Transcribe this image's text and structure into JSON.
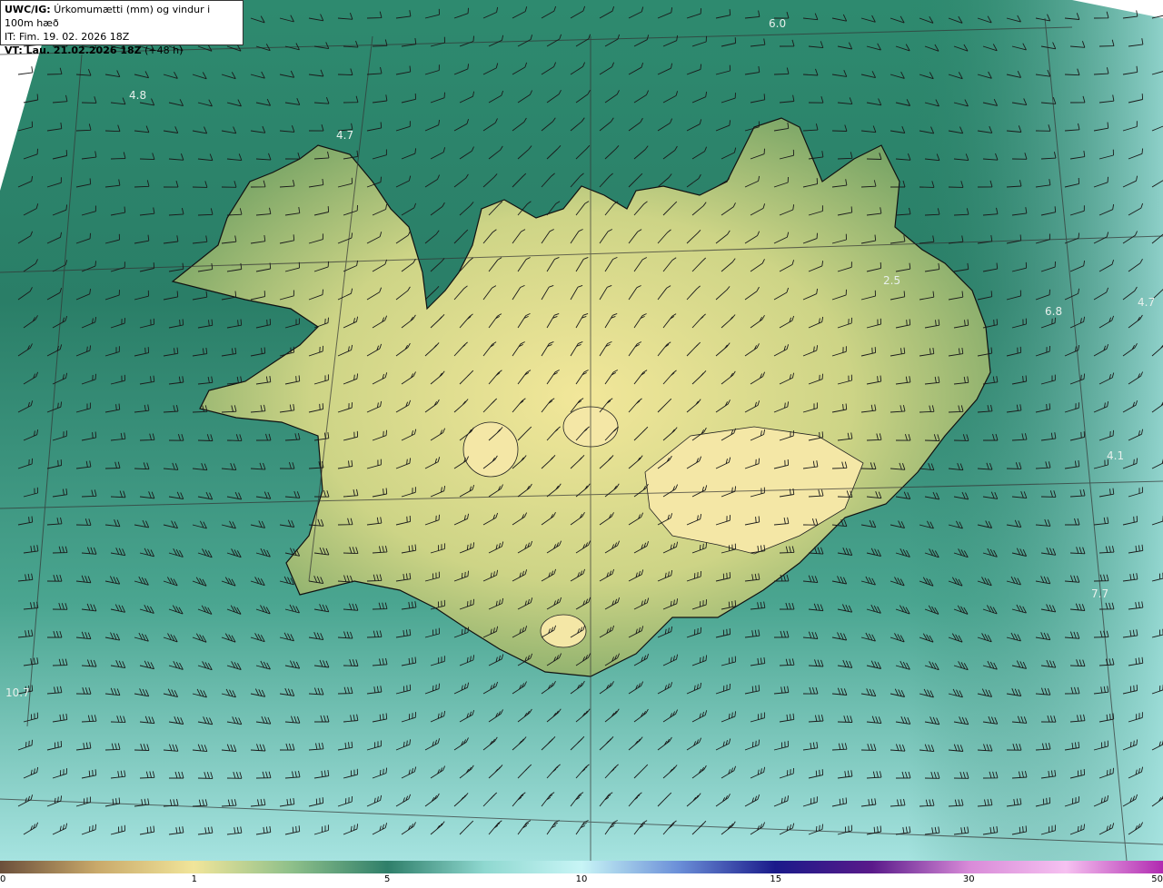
{
  "header": {
    "product": "UWC/IG:",
    "description": "Úrkomumætti (mm) og vindur i 100m hæð",
    "issue_time": "IT: Fim. 19. 02. 2026 18Z",
    "valid_prefix": "VT: Lau. 21.02.2026 18Z",
    "valid_suffix": "(+48 h)"
  },
  "colors": {
    "ocean_dark": "#1f6b5c",
    "ocean_light": "#a6e3e0",
    "land_low": "#6d9a58",
    "land_high": "#f2e79a",
    "coastline": "#111111",
    "barb": "#1a1a1a"
  },
  "map_labels": [
    {
      "text": "6.0"
    },
    {
      "text": "4.8"
    },
    {
      "text": "4.7"
    },
    {
      "text": "2.5"
    },
    {
      "text": "6.8"
    },
    {
      "text": "4.7"
    },
    {
      "text": "4.1"
    },
    {
      "text": "7.7"
    },
    {
      "text": "10.7"
    }
  ],
  "colorbar": {
    "ticks": [
      "0",
      "1",
      "5",
      "10",
      "15",
      "30",
      "50"
    ],
    "tick_values": [
      0,
      1,
      5,
      10,
      15,
      30,
      50
    ],
    "tick_fractions": [
      0,
      0.167,
      0.333,
      0.5,
      0.667,
      0.833,
      1
    ],
    "stops": [
      "#6b4f3b",
      "#c9a96a",
      "#f1e59a",
      "#8fc08a",
      "#2f7f6a",
      "#8fd8d0",
      "#c8f5f6",
      "#6b8fd8",
      "#1a1a8a",
      "#5a1a8a",
      "#d88ad8",
      "#f6c0f0",
      "#b02ab0"
    ]
  }
}
